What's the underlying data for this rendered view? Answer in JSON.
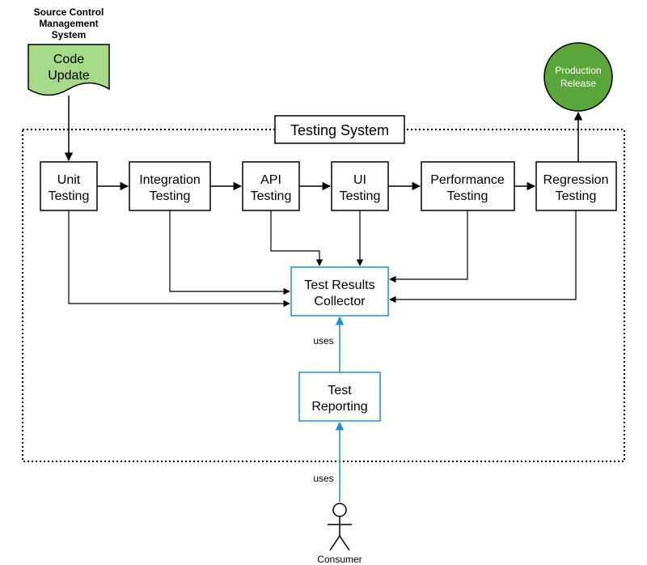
{
  "diagram": {
    "scm_label_l1": "Source Control",
    "scm_label_l2": "Management",
    "scm_label_l3": "System",
    "code_update_l1": "Code",
    "code_update_l2": "Update",
    "system_title": "Testing System",
    "unit_l1": "Unit",
    "unit_l2": "Testing",
    "integration_l1": "Integration",
    "integration_l2": "Testing",
    "api_l1": "API",
    "api_l2": "Testing",
    "ui_l1": "UI",
    "ui_l2": "Testing",
    "perf_l1": "Performance",
    "perf_l2": "Testing",
    "regression_l1": "Regression",
    "regression_l2": "Testing",
    "collector_l1": "Test Results",
    "collector_l2": "Collector",
    "reporting_l1": "Test",
    "reporting_l2": "Reporting",
    "prod_l1": "Production",
    "prod_l2": "Release",
    "uses_label": "uses",
    "consumer_label": "Consumer"
  },
  "colors": {
    "green_fill": "#a6d988",
    "green_dark": "#5aa63a",
    "blue": "#1d8fd6",
    "black": "#000000"
  }
}
